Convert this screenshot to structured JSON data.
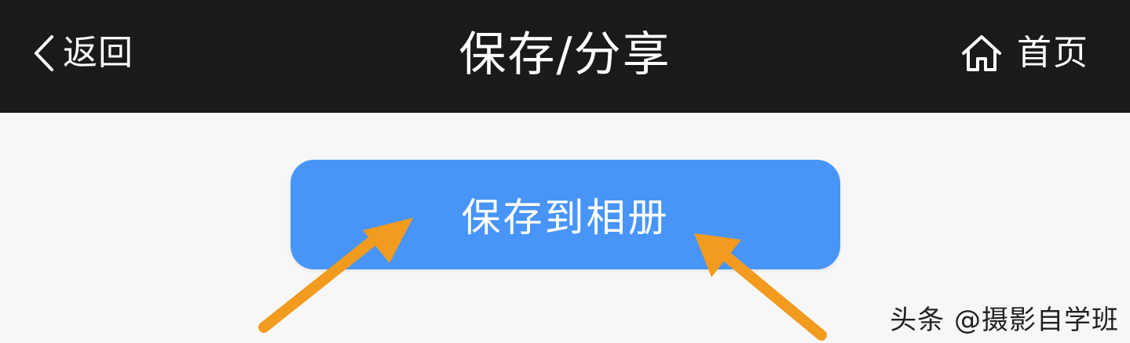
{
  "header": {
    "back_label": "返回",
    "title": "保存/分享",
    "home_label": "首页",
    "back_icon": "chevron-left-icon",
    "home_icon": "home-icon"
  },
  "main": {
    "save_button_label": "保存到相册"
  },
  "annotations": {
    "arrow_color": "#f29b1f"
  },
  "watermark": {
    "text": "头条 @摄影自学班"
  },
  "colors": {
    "header_bg": "#1a1a1a",
    "page_bg": "#f7f7f7",
    "button_bg": "#4895f7",
    "text_light": "#ffffff"
  }
}
